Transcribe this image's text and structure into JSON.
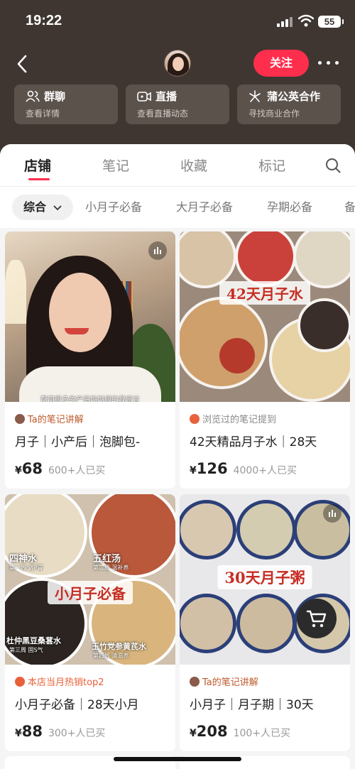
{
  "status_bar": {
    "time": "19:22",
    "battery": "55"
  },
  "header": {
    "follow_label": "关注"
  },
  "actions": [
    {
      "title": "群聊",
      "subtitle": "查看详情",
      "icon": "group-icon"
    },
    {
      "title": "直播",
      "subtitle": "查看直播动态",
      "icon": "live-camera-icon"
    },
    {
      "title": "蒲公英合作",
      "subtitle": "寻找商业合作",
      "icon": "dandelion-icon"
    }
  ],
  "tabs": [
    {
      "label": "店铺",
      "active": true
    },
    {
      "label": "笔记",
      "active": false
    },
    {
      "label": "收藏",
      "active": false
    },
    {
      "label": "标记",
      "active": false
    }
  ],
  "filters": [
    {
      "label": "综合",
      "active": true
    },
    {
      "label": "小月子必备",
      "active": false
    },
    {
      "label": "大月子必备",
      "active": false
    },
    {
      "label": "孕期必备",
      "active": false
    },
    {
      "label": "备",
      "active": false
    }
  ],
  "products": [
    {
      "tag": "Ta的笔记讲解",
      "title": "月子｜小产后｜泡脚包-",
      "price": "68",
      "sold": "600+人已买",
      "image_caption": "帮用很多的产后妈妈顺的我留言"
    },
    {
      "tag": "浏览过的笔记提到",
      "title": "42天精品月子水｜28天",
      "price": "126",
      "sold": "4000+人已买",
      "image_caption": "42天月子水"
    },
    {
      "tag": "本店当月热销top2",
      "title": "小月子必备｜28天小月",
      "price": "88",
      "sold": "300+人已买",
      "image_caption": "小月子必备",
      "plate_labels": [
        {
          "name": "四神水",
          "sub": "第一周 调P胃"
        },
        {
          "name": "五红汤",
          "sub": "第二周 温补养"
        },
        {
          "name": "杜仲黑豆桑葚水",
          "sub": "第三周 固S气"
        },
        {
          "name": "玉竹党参黄芪水",
          "sub": "第四周 清滋养"
        }
      ]
    },
    {
      "tag": "Ta的笔记讲解",
      "title": "小月子｜月子期｜30天",
      "price": "208",
      "sold": "100+人已买",
      "image_caption": "30天月子粥"
    }
  ],
  "currency": "¥",
  "colors": {
    "accent": "#ff2e4d",
    "header_bg": "#3f3631",
    "tag_orange": "#e8613a"
  }
}
